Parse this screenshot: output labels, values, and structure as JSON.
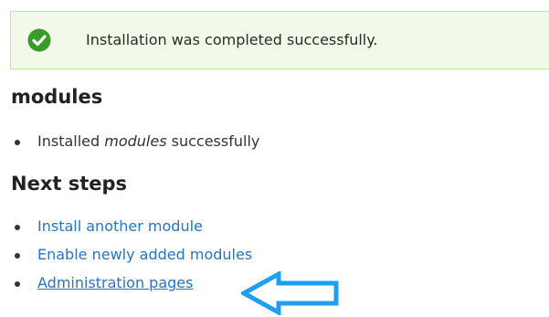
{
  "status": {
    "message": "Installation was completed successfully.",
    "icon": "check-circle-icon",
    "icon_color": "#3a9b2c",
    "background": "#f2f9e8",
    "border_color": "#c9e1a8"
  },
  "modules_section": {
    "heading": "modules",
    "items": [
      {
        "prefix": "Installed ",
        "emphasis": "modules",
        "suffix": " successfully"
      }
    ]
  },
  "next_steps": {
    "heading": "Next steps",
    "links": [
      {
        "label": "Install another module"
      },
      {
        "label": "Enable newly added modules"
      },
      {
        "label": "Administration pages"
      }
    ]
  },
  "annotation": {
    "icon": "arrow-left-icon",
    "color": "#1e9ff0"
  },
  "colors": {
    "link": "#2576c0",
    "text": "#333333"
  }
}
